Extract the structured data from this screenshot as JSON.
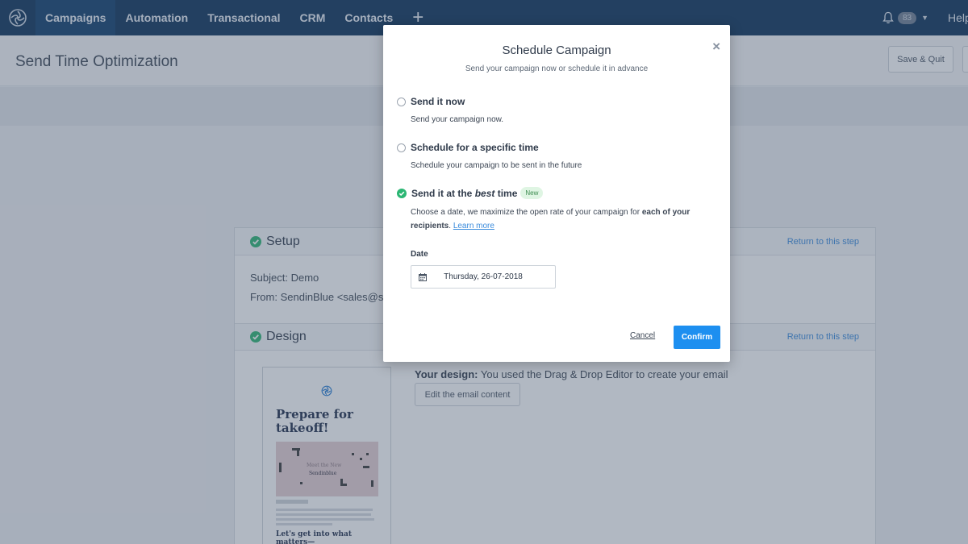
{
  "nav": {
    "items": [
      {
        "label": "Campaigns",
        "active": true
      },
      {
        "label": "Automation"
      },
      {
        "label": "Transactional"
      },
      {
        "label": "CRM"
      },
      {
        "label": "Contacts"
      }
    ],
    "plus_label": "+",
    "notification_count": "83",
    "help_label": "Help"
  },
  "page": {
    "title": "Send Time Optimization",
    "save_quit_label": "Save & Quit"
  },
  "setup": {
    "title": "Setup",
    "return_label": "Return to this step",
    "subject_label": "Subject:",
    "subject_value": "Demo",
    "from_label": "From:",
    "from_value": "SendinBlue <sales@se"
  },
  "design": {
    "title": "Design",
    "return_label": "Return to this step",
    "your_design_label": "Your design:",
    "your_design_text": "You used the Drag & Drop Editor to create your email",
    "edit_label": "Edit the email content",
    "preview": {
      "title": "Prepare for takeoff!",
      "image_text_1": "Meet the New",
      "image_text_2": "Sendinblue",
      "subheading": "Let's get into what matters—"
    }
  },
  "modal": {
    "title": "Schedule Campaign",
    "subtitle": "Send your campaign now or schedule it in advance",
    "close_glyph": "×",
    "options": [
      {
        "label": "Send it now",
        "description": "Send your campaign now.",
        "selected": false
      },
      {
        "label": "Schedule for a specific time",
        "description": "Schedule your campaign to be sent in the future",
        "selected": false
      },
      {
        "label_prefix": "Send it at the ",
        "label_em": "best",
        "label_suffix": " time",
        "tag": "New",
        "description_prefix": "Choose a date, we maximize the open rate of your campaign for ",
        "description_bold": "each of your recipients",
        "description_suffix": ".",
        "learn_more": "Learn more",
        "selected": true
      }
    ],
    "date_label": "Date",
    "date_value": "Thursday, 26-07-2018",
    "cancel_label": "Cancel",
    "confirm_label": "Confirm"
  },
  "colors": {
    "nav_bg": "#0b3158",
    "accent": "#1d8ff0",
    "success": "#2bb673",
    "link": "#3a8bdc"
  },
  "icons": [
    "sendinblue-logo-icon",
    "bell-icon",
    "check-circle-icon",
    "calendar-icon",
    "close-icon"
  ]
}
